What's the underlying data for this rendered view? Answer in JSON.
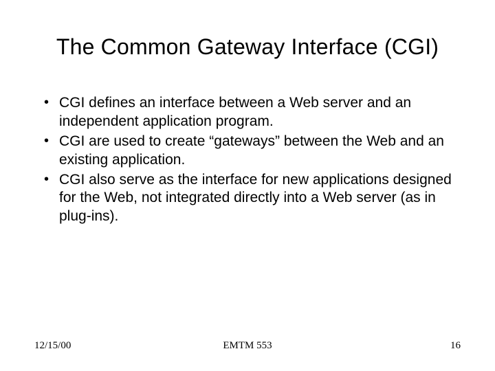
{
  "slide": {
    "title": "The Common Gateway Interface (CGI)",
    "bullets": [
      "CGI defines an interface between a Web server and an independent application program.",
      "CGI are used to create “gateways” between the Web and an existing application.",
      "CGI also serve as the interface for new applications designed for the Web, not integrated directly into a Web server (as in plug-ins)."
    ],
    "footer": {
      "date": "12/15/00",
      "course": "EMTM 553",
      "page": "16"
    }
  }
}
